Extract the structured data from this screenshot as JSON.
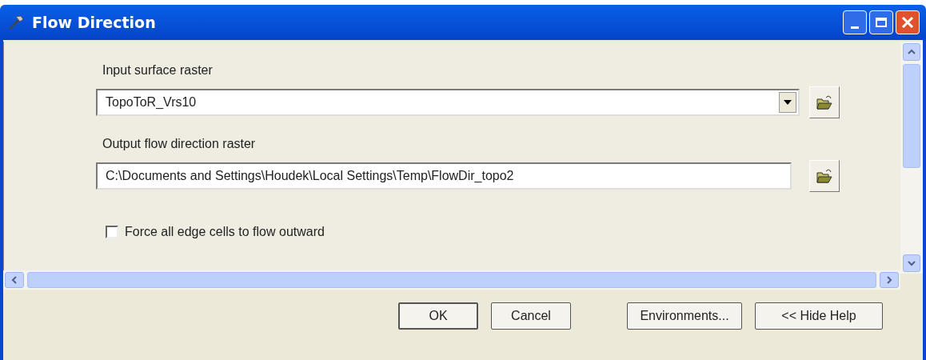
{
  "window": {
    "title": "Flow Direction"
  },
  "fields": [
    {
      "label": "Input surface raster",
      "value": "TopoToR_Vrs10",
      "kind": "dropdown"
    },
    {
      "label": "Output flow direction raster",
      "value": "C:\\Documents and Settings\\Houdek\\Local Settings\\Temp\\FlowDir_topo2",
      "kind": "text"
    }
  ],
  "checkbox": {
    "label": "Force all edge cells to flow outward",
    "checked": false
  },
  "buttons": [
    "OK",
    "Cancel",
    "Environments...",
    "<< Hide Help"
  ]
}
